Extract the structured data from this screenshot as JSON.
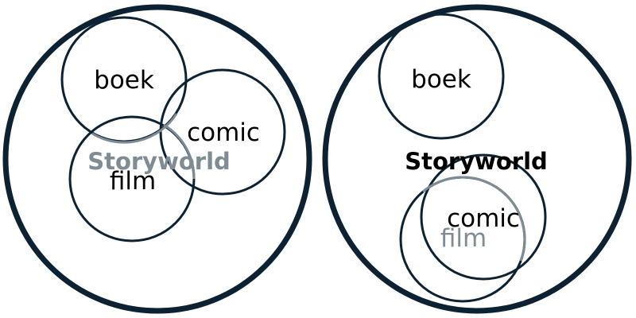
{
  "colors": {
    "stroke": "#0c2233",
    "faded": "#7f8c94",
    "text": "#000000",
    "background": "#ffffff"
  },
  "left": {
    "world_label": "Storyworld",
    "circles": {
      "boek": "boek",
      "comic": "comic",
      "film": "film"
    }
  },
  "right": {
    "world_label": "Storyworld",
    "circles": {
      "boek": "boek",
      "comic": "comic",
      "film": "film"
    }
  }
}
